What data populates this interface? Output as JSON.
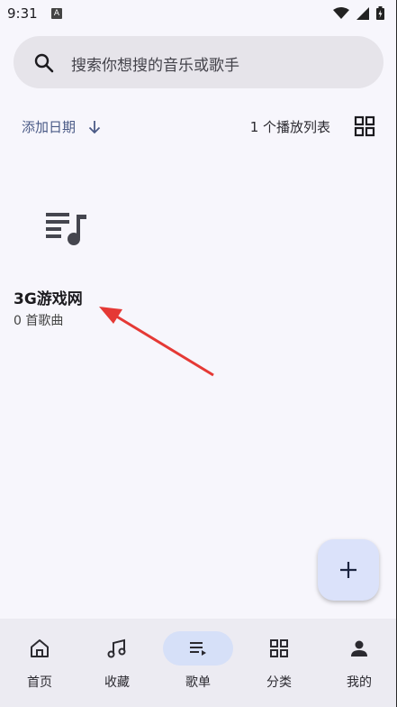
{
  "status": {
    "time": "9:31",
    "notif_badge": "A"
  },
  "search": {
    "placeholder": "搜索你想搜的音乐或歌手"
  },
  "toolbar": {
    "sort_label": "添加日期",
    "count_label": "1 个播放列表"
  },
  "playlists": [
    {
      "title": "3G游戏网",
      "subtitle": "0 首歌曲"
    }
  ],
  "nav": {
    "items": [
      {
        "label": "首页",
        "icon": "home-icon"
      },
      {
        "label": "收藏",
        "icon": "music-note-icon"
      },
      {
        "label": "歌单",
        "icon": "playlist-icon",
        "active": true
      },
      {
        "label": "分类",
        "icon": "grid-icon"
      },
      {
        "label": "我的",
        "icon": "person-icon"
      }
    ]
  },
  "colors": {
    "accent": "#4a5a86",
    "active_pill": "#d6e0f8",
    "fab": "#dbe2fa",
    "annotation_arrow": "#e53935"
  }
}
